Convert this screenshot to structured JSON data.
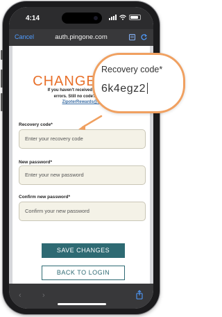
{
  "status_bar": {
    "time": "4:14"
  },
  "browser": {
    "cancel_label": "Cancel",
    "url": "auth.pingone.com"
  },
  "page": {
    "title": "CHANGE PAS",
    "help_line1": "If you haven't received an email, c",
    "help_line2": "errors. Still no code? Conta",
    "help_link": "ZipoterRewards@Z"
  },
  "form": {
    "recovery": {
      "label": "Recovery code*",
      "placeholder": "Enter your recovery code"
    },
    "new_password": {
      "label": "New password*",
      "placeholder": "Enter your new password"
    },
    "confirm_password": {
      "label": "Confirm new password*",
      "placeholder": "Confirm your new password"
    },
    "save_label": "SAVE CHANGES",
    "back_label": "BACK TO LOGIN"
  },
  "callout": {
    "label": "Recovery code*",
    "value": "6k4egz2"
  },
  "colors": {
    "accent_orange": "#e8702a",
    "button_teal": "#2e6a73",
    "field_bg": "#f4f2e7",
    "callout_border": "#f0a060"
  }
}
